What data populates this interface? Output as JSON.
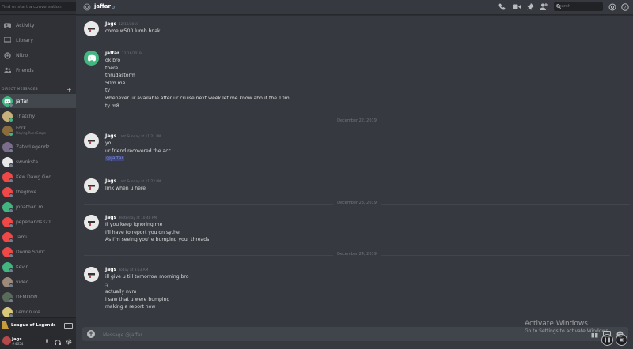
{
  "search": {
    "placeholder": "Find or start a conversation"
  },
  "nav": [
    {
      "label": "Activity",
      "icon": "gamepad-icon"
    },
    {
      "label": "Library",
      "icon": "library-icon"
    },
    {
      "label": "Nitro",
      "icon": "nitro-icon"
    },
    {
      "label": "Friends",
      "icon": "friends-icon"
    }
  ],
  "dm_header": "DIRECT MESSAGES",
  "dms": [
    {
      "name": "jaffar",
      "active": true
    },
    {
      "name": "Thatchy"
    },
    {
      "name": "Fork",
      "sub": "Playing RuneScape"
    },
    {
      "name": "ZatoxLegendz"
    },
    {
      "name": "swvnksta"
    },
    {
      "name": "Kew Dawg God"
    },
    {
      "name": "theglove"
    },
    {
      "name": "jonathan m"
    },
    {
      "name": "pepehands321"
    },
    {
      "name": "Tami"
    },
    {
      "name": "Divine Spirit"
    },
    {
      "name": "Kevin"
    },
    {
      "name": "video"
    },
    {
      "name": "DEMOON"
    },
    {
      "name": "Lemon ice"
    }
  ],
  "game": {
    "name": "League of Legends"
  },
  "user": {
    "name": "Jags",
    "tag": "#4654"
  },
  "channel": {
    "name": "jaffar"
  },
  "header_search": {
    "placeholder": "Search"
  },
  "messages": [
    {
      "author": "Jags",
      "timestamp": "12/16/2019",
      "lines": [
        "come w500 lumb bnak"
      ]
    },
    {
      "author": "jaffar",
      "timestamp": "12/16/2019",
      "lines": [
        "ok bro",
        "there",
        "thrudastorm",
        "50m me",
        "ty",
        "whenever ur available after ur cruise next week let me know about the 10m",
        "ty m8"
      ]
    },
    {
      "author": "Jags",
      "timestamp": "Last Sunday at 11:21 PM",
      "lines": [
        "yo",
        "ur friend recovered the acc"
      ],
      "mention": "@jaffar"
    },
    {
      "author": "Jags",
      "timestamp": "Last Sunday at 11:22 PM",
      "lines": [
        "lmk when u here"
      ]
    },
    {
      "author": "Jags",
      "timestamp": "Yesterday at 10:48 PM",
      "lines": [
        "If you keep ignoring me",
        "I'll have to report you on sythe",
        "As I'm seeing you're bumping your threads"
      ]
    },
    {
      "author": "Jags",
      "timestamp": "Today at 8:53 AM",
      "lines": [
        "ill give u till tomorrow morning bro",
        ":/",
        "actually nvm",
        "i saw that u were bumping",
        "making a report now"
      ]
    }
  ],
  "dividers": [
    "December 22, 2019",
    "December 23, 2019",
    "December 24, 2019"
  ],
  "composer": {
    "placeholder": "Message @jaffar"
  },
  "watermark": {
    "title": "Activate Windows",
    "subtitle": "Go to Settings to activate Windows."
  },
  "colors": {
    "blurple": "#7289da",
    "online": "#43b581",
    "idle": "#faa61a",
    "dnd": "#f04747",
    "offline": "#747f8d",
    "red_avatar": "#f04747",
    "green_avatar": "#43b581"
  }
}
